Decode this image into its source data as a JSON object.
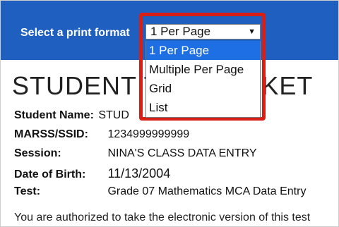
{
  "header": {
    "print_format_label": "Select a print format",
    "selected_format": "1 Per Page",
    "arrow_glyph": "▼",
    "format_options": [
      "1 Per Page",
      "Multiple Per Page",
      "Grid",
      "List"
    ]
  },
  "page": {
    "title": "STUDENT TEST TICKET"
  },
  "student": {
    "name_label": "Student Name:",
    "name_value": "STUD",
    "marss_label": "MARSS/SSID:",
    "marss_value": "1234999999999",
    "session_label": "Session:",
    "session_value": "NINA'S CLASS DATA ENTRY",
    "dob_label": "Date of Birth:",
    "dob_value": "11/13/2004",
    "test_label": "Test:",
    "test_value": "Grade 07 Mathematics MCA Data Entry"
  },
  "notice": {
    "text": "You are authorized to take the electronic version of this test"
  },
  "colors": {
    "header_bg": "#1f5fbf",
    "highlight_outline": "#d81e15",
    "selected_option_bg": "#1e6fe3"
  }
}
